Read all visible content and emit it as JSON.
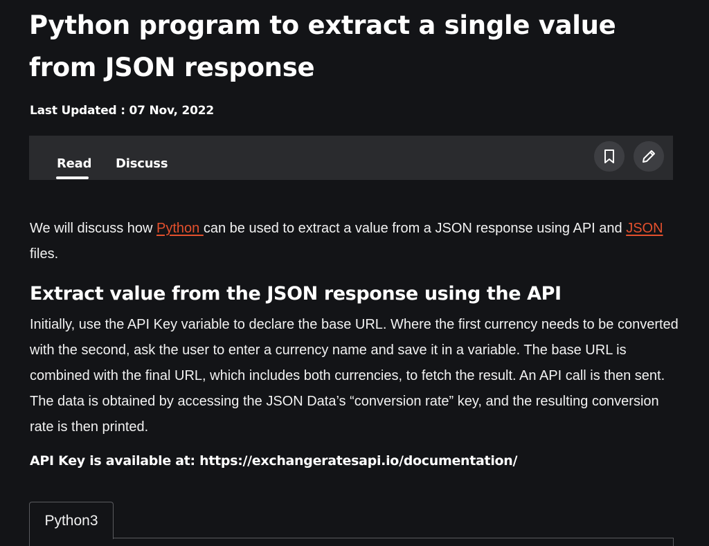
{
  "article": {
    "title": "Python program to extract a single value from JSON response",
    "last_updated": "Last Updated : 07 Nov, 2022"
  },
  "tabs": {
    "read": "Read",
    "discuss": "Discuss",
    "active": "Read"
  },
  "actions": {
    "bookmark_icon": "bookmark-icon",
    "edit_icon": "pencil-icon"
  },
  "intro": {
    "part1": "We will discuss how ",
    "link1": "Python ",
    "part2": "can be used to extract a value from a JSON response using API and ",
    "link2": "JSON",
    "part3": " files."
  },
  "section": {
    "heading": "Extract value from the JSON response using the API",
    "body": "Initially, use the API Key variable to declare the base URL. Where the first currency needs to be converted with the second, ask the user to enter a currency name and save it in a variable. The base URL is combined with the final URL, which includes both currencies, to fetch the result. An API call is then sent. The data is obtained by accessing the JSON Data’s “conversion rate” key, and the resulting conversion rate is then printed.",
    "api_key_note": "API Key is available at: https://exchangeratesapi.io/documentation/"
  },
  "code_block": {
    "tab_label": "Python3"
  },
  "colors": {
    "background": "#131417",
    "tabbar": "#2a2b2e",
    "link": "#e4502d",
    "text": "#ffffff"
  }
}
